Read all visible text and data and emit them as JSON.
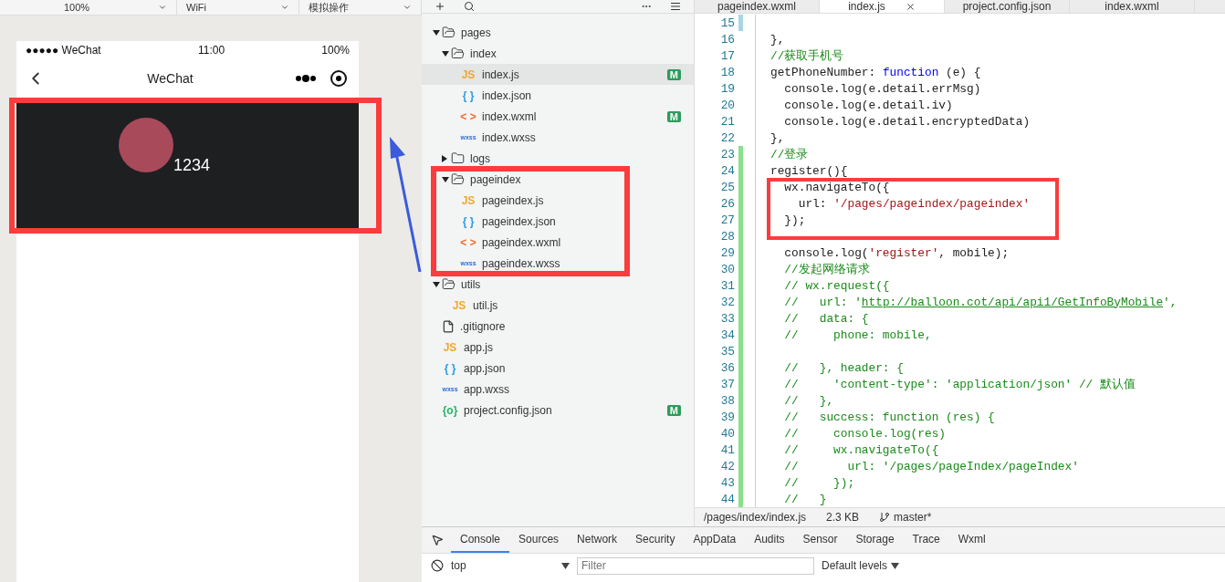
{
  "simulator": {
    "toolbar": [
      "100%",
      "WiFi",
      "模拟操作"
    ],
    "status_bar": {
      "carrier": "●●●●● WeChat",
      "time": "11:00",
      "battery": "100%"
    },
    "nav_bar": {
      "title": "WeChat"
    },
    "profile": {
      "name": "1234"
    }
  },
  "file_tree": [
    {
      "name": "pages",
      "kind": "folder",
      "expanded": true,
      "children": [
        {
          "name": "index",
          "kind": "folder",
          "expanded": true,
          "children": [
            {
              "name": "index.js",
              "kind": "js",
              "icon": "JS",
              "selected": true,
              "badge": "M"
            },
            {
              "name": "index.json",
              "kind": "json",
              "icon": "{ }",
              "selected": false
            },
            {
              "name": "index.wxml",
              "kind": "wxml",
              "icon": "< >",
              "selected": false,
              "badge": "M"
            },
            {
              "name": "index.wxss",
              "kind": "wxss",
              "icon": "wxss",
              "selected": false
            }
          ]
        },
        {
          "name": "logs",
          "kind": "folder",
          "expanded": false
        },
        {
          "name": "pageindex",
          "kind": "folder",
          "expanded": true,
          "children": [
            {
              "name": "pageindex.js",
              "kind": "js",
              "icon": "JS",
              "selected": false
            },
            {
              "name": "pageindex.json",
              "kind": "json",
              "icon": "{ }",
              "selected": false
            },
            {
              "name": "pageindex.wxml",
              "kind": "wxml",
              "icon": "< >",
              "selected": false
            },
            {
              "name": "pageindex.wxss",
              "kind": "wxss",
              "icon": "wxss",
              "selected": false
            }
          ]
        }
      ]
    },
    {
      "name": "utils",
      "kind": "folder",
      "expanded": true,
      "children": [
        {
          "name": "util.js",
          "kind": "js",
          "icon": "JS",
          "selected": false
        }
      ]
    },
    {
      "name": ".gitignore",
      "kind": "file",
      "selected": false
    },
    {
      "name": "app.js",
      "kind": "js",
      "icon": "JS",
      "selected": false
    },
    {
      "name": "app.json",
      "kind": "json",
      "icon": "{ }",
      "selected": false
    },
    {
      "name": "app.wxss",
      "kind": "wxss",
      "icon": "wxss",
      "selected": false
    },
    {
      "name": "project.config.json",
      "kind": "config",
      "icon": "{o}",
      "selected": false,
      "badge": "M"
    }
  ],
  "editor_tabs": [
    {
      "label": "pageindex.wxml",
      "selected": false
    },
    {
      "label": "index.js",
      "selected": true
    },
    {
      "label": "project.config.json",
      "selected": false
    },
    {
      "label": "index.wxml",
      "selected": false
    }
  ],
  "code_lines": [
    {
      "number": "15",
      "kind": "modified"
    },
    {
      "number": "16",
      "tokens": [
        {
          "text": "},",
          "kind": "plain"
        }
      ]
    },
    {
      "number": "17",
      "tokens": [
        {
          "text": "//获取手机号",
          "kind": "comment"
        }
      ]
    },
    {
      "number": "18",
      "tokens": [
        {
          "text": "getPhoneNumber: ",
          "kind": "plain"
        },
        {
          "text": "function",
          "kind": "keyword"
        },
        {
          "text": " (e) {",
          "kind": "plain"
        }
      ]
    },
    {
      "number": "19",
      "tokens": [
        {
          "text": "  console.log(e.detail.errMsg)",
          "kind": "plain"
        }
      ]
    },
    {
      "number": "20",
      "tokens": [
        {
          "text": "  console.log(e.detail.iv)",
          "kind": "plain"
        }
      ]
    },
    {
      "number": "21",
      "tokens": [
        {
          "text": "  console.log(e.detail.encryptedData)",
          "kind": "plain"
        }
      ]
    },
    {
      "number": "22",
      "tokens": [
        {
          "text": "},",
          "kind": "plain"
        }
      ]
    },
    {
      "number": "23",
      "kind": "added",
      "tokens": [
        {
          "text": "//登录",
          "kind": "comment"
        }
      ]
    },
    {
      "number": "24",
      "kind": "added",
      "tokens": [
        {
          "text": "register(){",
          "kind": "plain"
        }
      ]
    },
    {
      "number": "25",
      "kind": "added",
      "tokens": [
        {
          "text": "  wx.navigateTo({",
          "kind": "plain"
        }
      ]
    },
    {
      "number": "26",
      "kind": "added",
      "tokens": [
        {
          "text": "    url: ",
          "kind": "plain"
        },
        {
          "text": "'/pages/pageindex/pageindex'",
          "kind": "string"
        }
      ]
    },
    {
      "number": "27",
      "kind": "added",
      "tokens": [
        {
          "text": "  });",
          "kind": "plain"
        }
      ]
    },
    {
      "number": "28",
      "kind": "added"
    },
    {
      "number": "29",
      "kind": "added",
      "tokens": [
        {
          "text": "  console.log(",
          "kind": "plain"
        },
        {
          "text": "'register'",
          "kind": "string"
        },
        {
          "text": ", mobile);",
          "kind": "plain"
        }
      ]
    },
    {
      "number": "30",
      "kind": "added",
      "tokens": [
        {
          "text": "  //发起网络请求",
          "kind": "comment"
        }
      ]
    },
    {
      "number": "31",
      "kind": "added",
      "tokens": [
        {
          "text": "  // wx.request({",
          "kind": "comment"
        }
      ]
    },
    {
      "number": "32",
      "kind": "added",
      "tokens": [
        {
          "text": "  //   url: '",
          "kind": "comment"
        },
        {
          "text": "http://balloon.cot/api/api1/GetInfoByMobile",
          "kind": "link"
        },
        {
          "text": "',",
          "kind": "comment"
        }
      ]
    },
    {
      "number": "33",
      "kind": "added",
      "tokens": [
        {
          "text": "  //   data: {",
          "kind": "comment"
        }
      ]
    },
    {
      "number": "34",
      "kind": "added",
      "tokens": [
        {
          "text": "  //     phone: mobile,",
          "kind": "comment"
        }
      ]
    },
    {
      "number": "35",
      "kind": "added"
    },
    {
      "number": "36",
      "kind": "added",
      "tokens": [
        {
          "text": "  //   }, header: {",
          "kind": "comment"
        }
      ]
    },
    {
      "number": "37",
      "kind": "added",
      "tokens": [
        {
          "text": "  //     'content-type': 'application/json' // 默认值",
          "kind": "comment"
        }
      ]
    },
    {
      "number": "38",
      "kind": "added",
      "tokens": [
        {
          "text": "  //   },",
          "kind": "comment"
        }
      ]
    },
    {
      "number": "39",
      "kind": "added",
      "tokens": [
        {
          "text": "  //   success: function (res) {",
          "kind": "comment"
        }
      ]
    },
    {
      "number": "40",
      "kind": "added",
      "tokens": [
        {
          "text": "  //     console.log(res)",
          "kind": "comment"
        }
      ]
    },
    {
      "number": "41",
      "kind": "added",
      "tokens": [
        {
          "text": "  //     wx.navigateTo({",
          "kind": "comment"
        }
      ]
    },
    {
      "number": "42",
      "kind": "added",
      "tokens": [
        {
          "text": "  //       url: '/pages/pageIndex/pageIndex'",
          "kind": "comment"
        }
      ]
    },
    {
      "number": "43",
      "kind": "added",
      "tokens": [
        {
          "text": "  //     });",
          "kind": "comment"
        }
      ]
    },
    {
      "number": "44",
      "kind": "added",
      "tokens": [
        {
          "text": "  //   }",
          "kind": "comment"
        }
      ]
    }
  ],
  "editor_status": {
    "path": "/pages/index/index.js",
    "size": "2.3 KB",
    "branch": "master*"
  },
  "devtools": {
    "tabs": [
      {
        "label": "Console",
        "selected": true
      },
      {
        "label": "Sources",
        "selected": false
      },
      {
        "label": "Network",
        "selected": false
      },
      {
        "label": "Security",
        "selected": false
      },
      {
        "label": "AppData",
        "selected": false
      },
      {
        "label": "Audits",
        "selected": false
      },
      {
        "label": "Sensor",
        "selected": false
      },
      {
        "label": "Storage",
        "selected": false
      },
      {
        "label": "Trace",
        "selected": false
      },
      {
        "label": "Wxml",
        "selected": false
      }
    ],
    "context": "top",
    "filter": {
      "placeholder": "Filter"
    },
    "levels": "Default levels"
  }
}
